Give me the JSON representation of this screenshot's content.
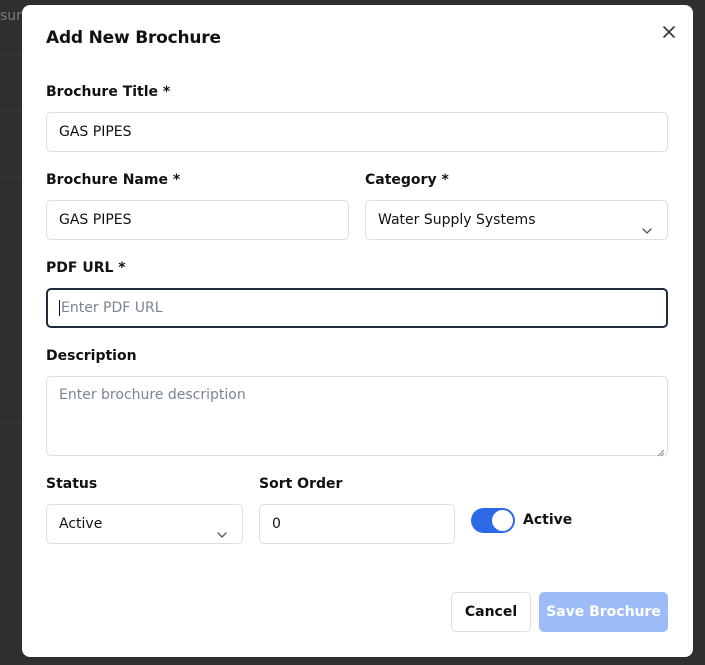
{
  "background": {
    "partial_text": "sum"
  },
  "modal": {
    "title": "Add New Brochure",
    "close_icon": "close-icon"
  },
  "form": {
    "brochure_title": {
      "label": "Brochure Title *",
      "value": "GAS PIPES"
    },
    "brochure_name": {
      "label": "Brochure Name *",
      "value": "GAS PIPES"
    },
    "category": {
      "label": "Category *",
      "value": "Water Supply Systems"
    },
    "pdf_url": {
      "label": "PDF URL *",
      "value": "",
      "placeholder": "Enter PDF URL"
    },
    "description": {
      "label": "Description",
      "value": "",
      "placeholder": "Enter brochure description"
    },
    "status": {
      "label": "Status",
      "value": "Active"
    },
    "sort_order": {
      "label": "Sort Order",
      "value": "0"
    },
    "active_toggle": {
      "label": "Active",
      "on": true
    }
  },
  "actions": {
    "cancel_label": "Cancel",
    "save_label": "Save Brochure"
  },
  "colors": {
    "accent": "#2c69e6",
    "save_disabled": "#9dbcf7",
    "overlay": "#2f2f2f"
  }
}
